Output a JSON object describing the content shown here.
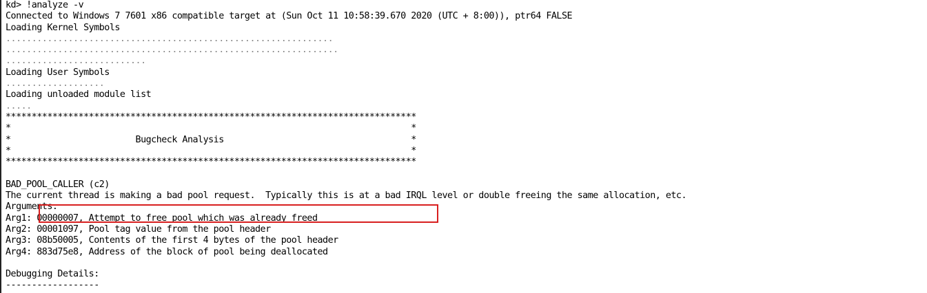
{
  "console": {
    "accent_color": "#d81e1e",
    "lines": [
      {
        "text": "kd> !analyze -v",
        "dim": false
      },
      {
        "text": "Connected to Windows 7 7601 x86 compatible target at (Sun Oct 11 10:58:39.670 2020 (UTC + 8:00)), ptr64 FALSE",
        "dim": false
      },
      {
        "text": "Loading Kernel Symbols",
        "dim": false
      },
      {
        "text": "...............................................................",
        "dim": true
      },
      {
        "text": "................................................................",
        "dim": true
      },
      {
        "text": "...........................",
        "dim": true
      },
      {
        "text": "Loading User Symbols",
        "dim": false
      },
      {
        "text": "...................",
        "dim": true
      },
      {
        "text": "Loading unloaded module list",
        "dim": false
      },
      {
        "text": ".....",
        "dim": true
      },
      {
        "text": "*******************************************************************************",
        "dim": false
      },
      {
        "text": "*                                                                             *",
        "dim": false
      },
      {
        "text": "*                        Bugcheck Analysis                                    *",
        "dim": false
      },
      {
        "text": "*                                                                             *",
        "dim": false
      },
      {
        "text": "*******************************************************************************",
        "dim": false
      },
      {
        "text": "",
        "dim": false
      },
      {
        "text": "BAD_POOL_CALLER (c2)",
        "dim": false
      },
      {
        "text": "The current thread is making a bad pool request.  Typically this is at a bad IRQL level or double freeing the same allocation, etc.",
        "dim": false
      },
      {
        "text": "Arguments:",
        "dim": false
      },
      {
        "text": "Arg1: 00000007, Attempt to free pool which was already freed",
        "dim": false
      },
      {
        "text": "Arg2: 00001097, Pool tag value from the pool header",
        "dim": false
      },
      {
        "text": "Arg3: 08b50005, Contents of the first 4 bytes of the pool header",
        "dim": false
      },
      {
        "text": "Arg4: 883d75e8, Address of the block of pool being deallocated",
        "dim": false
      },
      {
        "text": "",
        "dim": false
      },
      {
        "text": "Debugging Details:",
        "dim": false
      },
      {
        "text": "------------------",
        "dim": false
      }
    ]
  }
}
